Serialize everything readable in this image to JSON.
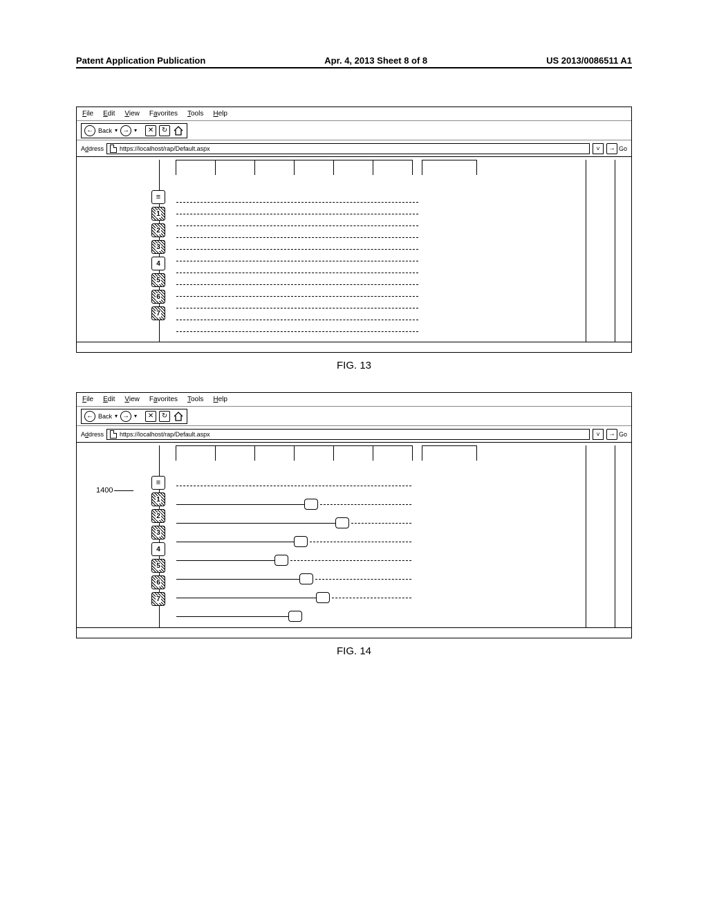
{
  "header": {
    "left": "Patent Application Publication",
    "center": "Apr. 4, 2013  Sheet 8 of 8",
    "right": "US 2013/0086511 A1"
  },
  "menubar": {
    "file": "File",
    "edit": "Edit",
    "view": "View",
    "favorites": "Favorites",
    "tools": "Tools",
    "help": "Help"
  },
  "toolbar": {
    "back": "Back"
  },
  "addressbar": {
    "label": "Address",
    "url": "https://localhost/rap/Default.aspx",
    "go": "Go"
  },
  "nav": {
    "tabs": [
      "",
      "1",
      "2",
      "3",
      "4",
      "5",
      "6",
      "7"
    ],
    "hatched": [
      false,
      true,
      true,
      true,
      false,
      true,
      true,
      true
    ]
  },
  "fig13": {
    "caption": "FIG. 13"
  },
  "fig14": {
    "caption": "FIG. 14",
    "callout": "1400"
  }
}
